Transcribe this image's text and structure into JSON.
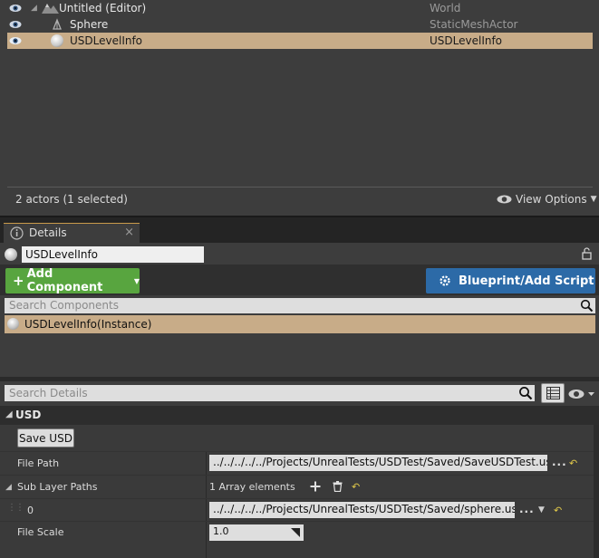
{
  "outliner": {
    "rows": [
      {
        "label": "Untitled (Editor)",
        "type": "World",
        "selected": false
      },
      {
        "label": "Sphere",
        "type": "StaticMeshActor",
        "selected": false
      },
      {
        "label": "USDLevelInfo",
        "type": "USDLevelInfo",
        "selected": true
      }
    ],
    "actors_count": "2 actors (1 selected)",
    "view_options": "View Options"
  },
  "details": {
    "tab_label": "Details",
    "tab_close": "×",
    "actor_name": "USDLevelInfo",
    "add_component": "Add Component",
    "add_component_plus": "+",
    "blueprint_button": "Blueprint/Add Script",
    "search_components_placeholder": "Search Components",
    "component_instance": "USDLevelInfo(Instance)",
    "search_details_placeholder": "Search Details",
    "category": {
      "name": "USD",
      "save_button": "Save USD",
      "file_path_label": "File Path",
      "file_path_value": "../../../../../Projects/UnrealTests/USDTest/Saved/SaveUSDTest.usda",
      "sub_layer_label": "Sub Layer Paths",
      "sub_layer_count": "1 Array elements",
      "sub_layer_index": "0",
      "sub_layer_value": "../../../../../Projects/UnrealTests/USDTest/Saved/sphere.usda",
      "file_scale_label": "File Scale",
      "file_scale_value": "1.0"
    }
  },
  "colors": {
    "selection": "#c8ac88",
    "add_component": "#58a53f",
    "blueprint": "#2c6aa7",
    "panel": "#3d3d3d"
  },
  "icons": [
    "eye-icon",
    "world-icon",
    "static-mesh-icon",
    "sphere-actor-icon",
    "lock-icon",
    "search-icon",
    "gear-icon",
    "plus-icon",
    "trash-icon",
    "reset-arrow-icon",
    "grid-view-icon",
    "visibility-filter-icon",
    "dropdown-arrow-icon"
  ]
}
